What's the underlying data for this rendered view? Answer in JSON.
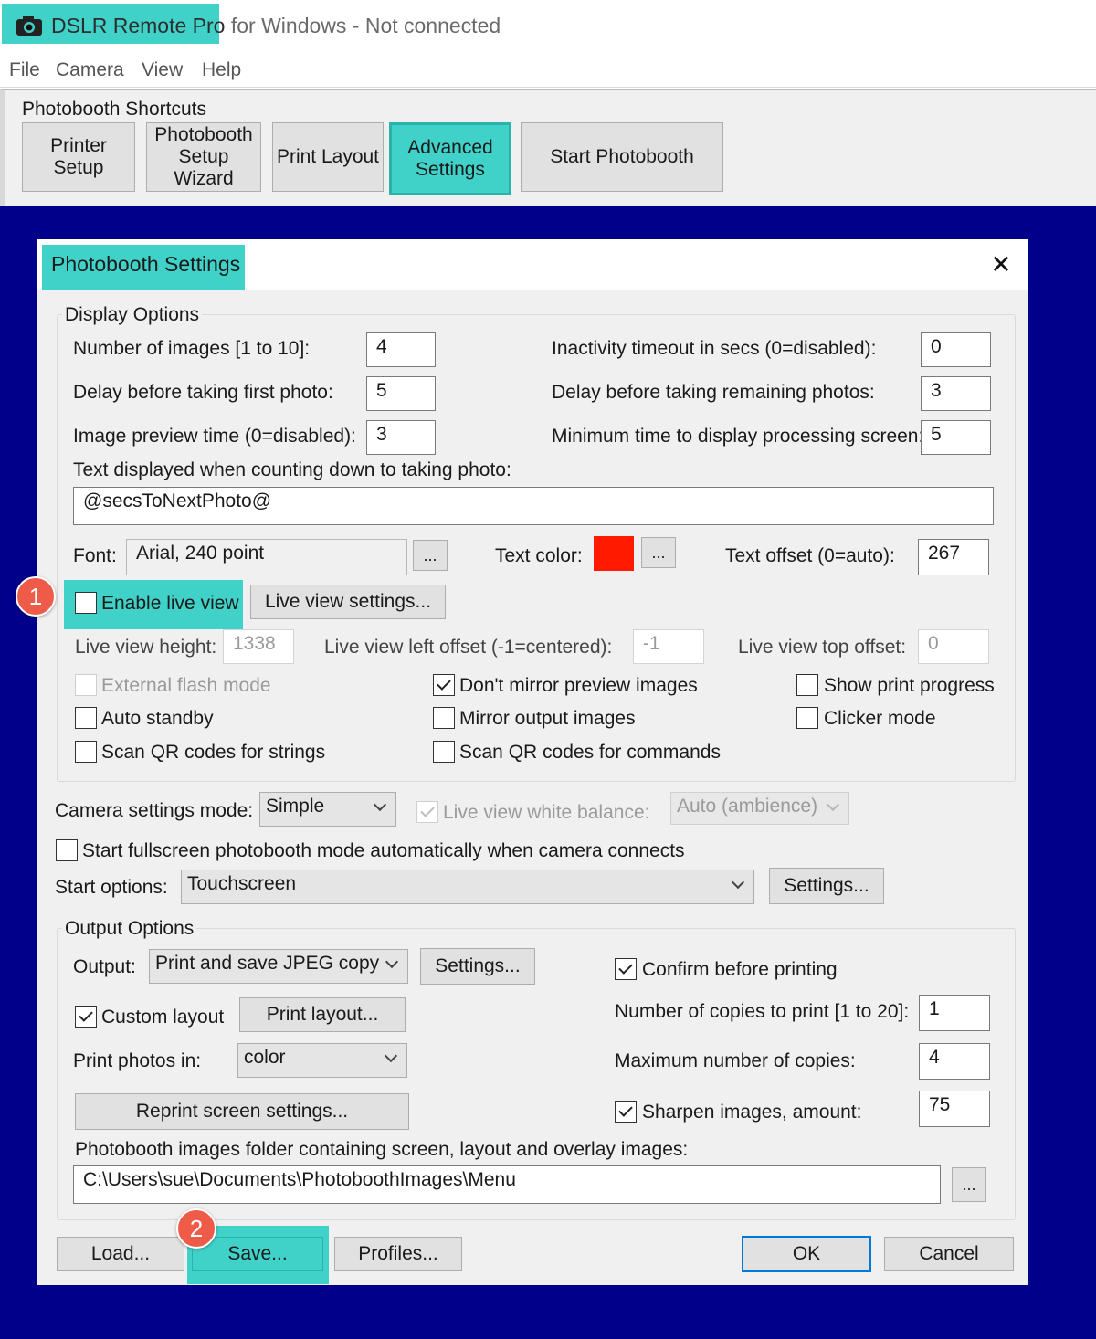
{
  "window": {
    "title_app": "DSLR Remote Pro",
    "title_rest": " for Windows - Not connected"
  },
  "menu": [
    "File",
    "Camera",
    "View",
    "Help"
  ],
  "shortcuts": {
    "label": "Photobooth Shortcuts",
    "buttons": {
      "printer_setup": "Printer Setup",
      "wizard_line1": "Photobooth",
      "wizard_line2": "Setup Wizard",
      "print_layout": "Print Layout",
      "advanced_line1": "Advanced",
      "advanced_line2": "Settings",
      "start": "Start Photobooth"
    }
  },
  "dialog": {
    "title": "Photobooth Settings",
    "close_glyph": "✕",
    "display_options": {
      "group_label": "Display Options",
      "num_images_label": "Number of images [1 to 10]:",
      "num_images": "4",
      "inactivity_label": "Inactivity timeout in secs (0=disabled):",
      "inactivity": "0",
      "delay_first_label": "Delay before taking first photo:",
      "delay_first": "5",
      "delay_remaining_label": "Delay before taking remaining photos:",
      "delay_remaining": "3",
      "preview_time_label": "Image preview time (0=disabled):",
      "preview_time": "3",
      "min_processing_label": "Minimum time to display processing screen:",
      "min_processing": "5",
      "countdown_text_label": "Text displayed when counting down to taking photo:",
      "countdown_text": "@secsToNextPhoto@",
      "font_label": "Font:",
      "font_value": "Arial, 240 point",
      "ellipsis": "...",
      "text_color_label": "Text color:",
      "text_color": "#ff1a00",
      "text_offset_label": "Text offset (0=auto):",
      "text_offset": "267",
      "enable_live_view": "Enable live view",
      "live_view_settings": "Live view settings...",
      "live_view_height_label": "Live view height:",
      "live_view_height": "1338",
      "live_view_left_label": "Live view left offset (-1=centered):",
      "live_view_left": "-1",
      "live_view_top_label": "Live view top offset:",
      "live_view_top": "0",
      "external_flash": "External flash mode",
      "dont_mirror": "Don't mirror preview images",
      "show_print_progress": "Show print progress",
      "auto_standby": "Auto standby",
      "mirror_output": "Mirror output images",
      "clicker_mode": "Clicker mode",
      "scan_qr_strings": "Scan QR codes for strings",
      "scan_qr_commands": "Scan QR codes for commands"
    },
    "camera": {
      "mode_label": "Camera settings mode:",
      "mode": "Simple",
      "wb_label": "Live view white balance:",
      "wb": "Auto (ambience)",
      "fullscreen_auto": "Start fullscreen photobooth mode automatically when camera connects",
      "start_options_label": "Start options:",
      "start_options": "Touchscreen",
      "settings_btn": "Settings..."
    },
    "output_options": {
      "group_label": "Output Options",
      "output_label": "Output:",
      "output": "Print and save JPEG copy",
      "settings_btn": "Settings...",
      "confirm_printing": "Confirm before printing",
      "custom_layout": "Custom layout",
      "print_layout_btn": "Print layout...",
      "copies_label": "Number of copies to print [1 to 20]:",
      "copies": "1",
      "print_in_label": "Print photos in:",
      "print_in": "color",
      "max_copies_label": "Maximum number of copies:",
      "max_copies": "4",
      "reprint_btn": "Reprint screen settings...",
      "sharpen_label": "Sharpen images, amount:",
      "sharpen": "75",
      "folder_label": "Photobooth images folder containing screen, layout and overlay images:",
      "folder": "C:\\Users\\sue\\Documents\\PhotoboothImages\\Menu",
      "ellipsis": "..."
    },
    "footer": {
      "load": "Load...",
      "save": "Save...",
      "profiles": "Profiles...",
      "ok": "OK",
      "cancel": "Cancel"
    }
  },
  "callouts": [
    "1",
    "2"
  ],
  "colors": {
    "highlight": "#40d2c8",
    "backdrop": "#00008b",
    "badge": "#ee5b48"
  }
}
